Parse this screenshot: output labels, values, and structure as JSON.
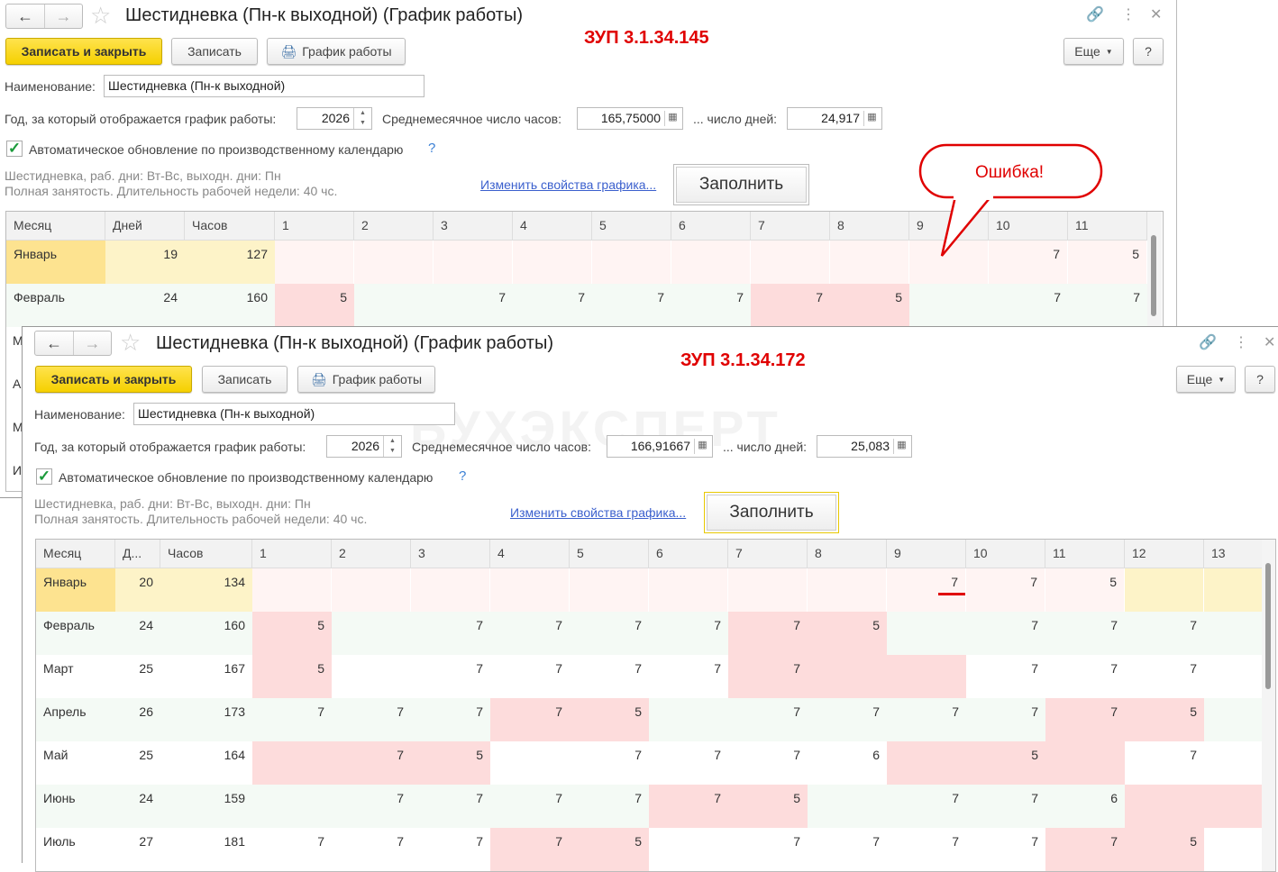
{
  "back": {
    "title": "Шестидневка (Пн-к выходной) (График работы)",
    "version": "ЗУП 3.1.34.145",
    "buttons": {
      "save_close": "Записать и закрыть",
      "save": "Записать",
      "schedule": "График работы",
      "more": "Еще",
      "help": "?"
    },
    "name_label": "Наименование:",
    "name_value": "Шестидневка (Пн-к выходной)",
    "year_label": "Год, за который отображается график работы:",
    "year_value": "2026",
    "avg_hours_label": "Среднемесячное число часов:",
    "avg_hours_value": "165,75000",
    "avg_days_label": "... число дней:",
    "avg_days_value": "24,917",
    "auto_update_label": "Автоматическое обновление по производственному календарю",
    "auto_update_checked": true,
    "info_line1": "Шестидневка, раб. дни: Вт-Вс, выходн. дни: Пн",
    "info_line2": "Полная занятость. Длительность рабочей недели: 40 чс.",
    "change_link": "Изменить свойства графика...",
    "fill_button": "Заполнить",
    "columns": [
      "Месяц",
      "Дней",
      "Часов",
      "1",
      "2",
      "3",
      "4",
      "5",
      "6",
      "7",
      "8",
      "9",
      "10",
      "11"
    ],
    "rows": [
      {
        "month": "Январь",
        "days": "19",
        "hours": "127",
        "cells": [
          "",
          "",
          "",
          "",
          "",
          "",
          "",
          "",
          "",
          "7",
          "5"
        ],
        "pink": [
          1,
          1,
          1,
          1,
          1,
          1,
          1,
          1,
          1,
          1,
          1
        ]
      },
      {
        "month": "Февраль",
        "days": "24",
        "hours": "160",
        "cells": [
          "5",
          "",
          "7",
          "7",
          "7",
          "7",
          "7",
          "5",
          "",
          "7",
          "7"
        ],
        "pink": [
          1,
          0,
          0,
          0,
          0,
          0,
          1,
          1,
          0,
          0,
          0
        ]
      }
    ],
    "hidden_row_initials": [
      "М",
      "А",
      "М",
      "И"
    ]
  },
  "callout": {
    "text": "Ошибка!"
  },
  "watermark": "БУХЭКСПЕРТ",
  "front": {
    "title": "Шестидневка (Пн-к выходной) (График работы)",
    "version": "ЗУП 3.1.34.172",
    "buttons": {
      "save_close": "Записать и закрыть",
      "save": "Записать",
      "schedule": "График работы",
      "more": "Еще",
      "help": "?"
    },
    "name_label": "Наименование:",
    "name_value": "Шестидневка (Пн-к выходной)",
    "year_label": "Год, за который отображается график работы:",
    "year_value": "2026",
    "avg_hours_label": "Среднемесячное число часов:",
    "avg_hours_value": "166,91667",
    "avg_days_label": "... число дней:",
    "avg_days_value": "25,083",
    "auto_update_label": "Автоматическое обновление по производственному календарю",
    "auto_update_checked": true,
    "info_line1": "Шестидневка, раб. дни: Вт-Вс, выходн. дни: Пн",
    "info_line2": "Полная занятость. Длительность рабочей недели: 40 чс.",
    "change_link": "Изменить свойства графика...",
    "fill_button": "Заполнить",
    "columns": [
      "Месяц",
      "Д...",
      "Часов",
      "1",
      "2",
      "3",
      "4",
      "5",
      "6",
      "7",
      "8",
      "9",
      "10",
      "11",
      "12",
      "13"
    ],
    "rows": [
      {
        "month": "Январь",
        "days": "20",
        "hours": "134",
        "cells": [
          "",
          "",
          "",
          "",
          "",
          "",
          "",
          "",
          "7",
          "7",
          "5",
          "",
          ""
        ],
        "pink": [
          1,
          1,
          1,
          1,
          1,
          1,
          1,
          1,
          1,
          1,
          1,
          0,
          0
        ],
        "highlight": 8
      },
      {
        "month": "Февраль",
        "days": "24",
        "hours": "160",
        "cells": [
          "5",
          "",
          "7",
          "7",
          "7",
          "7",
          "7",
          "5",
          "",
          "7",
          "7",
          "7",
          ""
        ],
        "pink": [
          1,
          0,
          0,
          0,
          0,
          0,
          1,
          1,
          0,
          0,
          0,
          0,
          0
        ]
      },
      {
        "month": "Март",
        "days": "25",
        "hours": "167",
        "cells": [
          "5",
          "",
          "7",
          "7",
          "7",
          "7",
          "7",
          "",
          "",
          "7",
          "7",
          "7",
          ""
        ],
        "pink": [
          1,
          0,
          0,
          0,
          0,
          0,
          1,
          1,
          1,
          0,
          0,
          0,
          0
        ]
      },
      {
        "month": "Апрель",
        "days": "26",
        "hours": "173",
        "cells": [
          "7",
          "7",
          "7",
          "7",
          "5",
          "",
          "7",
          "7",
          "7",
          "7",
          "7",
          "5",
          ""
        ],
        "pink": [
          0,
          0,
          0,
          1,
          1,
          0,
          0,
          0,
          0,
          0,
          1,
          1,
          0
        ]
      },
      {
        "month": "Май",
        "days": "25",
        "hours": "164",
        "cells": [
          "",
          "7",
          "5",
          "",
          "7",
          "7",
          "7",
          "6",
          "",
          "5",
          "",
          "7",
          ""
        ],
        "pink": [
          1,
          1,
          1,
          0,
          0,
          0,
          0,
          0,
          1,
          1,
          1,
          0,
          0
        ]
      },
      {
        "month": "Июнь",
        "days": "24",
        "hours": "159",
        "cells": [
          "",
          "7",
          "7",
          "7",
          "7",
          "7",
          "5",
          "",
          "7",
          "7",
          "6",
          "",
          ""
        ],
        "pink": [
          0,
          0,
          0,
          0,
          0,
          1,
          1,
          0,
          0,
          0,
          0,
          1,
          1
        ]
      },
      {
        "month": "Июль",
        "days": "27",
        "hours": "181",
        "cells": [
          "7",
          "7",
          "7",
          "7",
          "5",
          "",
          "7",
          "7",
          "7",
          "7",
          "7",
          "5",
          ""
        ],
        "pink": [
          0,
          0,
          0,
          1,
          1,
          0,
          0,
          0,
          0,
          0,
          1,
          1,
          0
        ]
      }
    ]
  },
  "colors": {
    "pink": "#fddcdc",
    "pink_light": "#fff4f3",
    "yellow": "#fdf3c8",
    "yellow_dark": "#fde390",
    "green_row": "#f4faf5",
    "error_red": "#e00000"
  }
}
